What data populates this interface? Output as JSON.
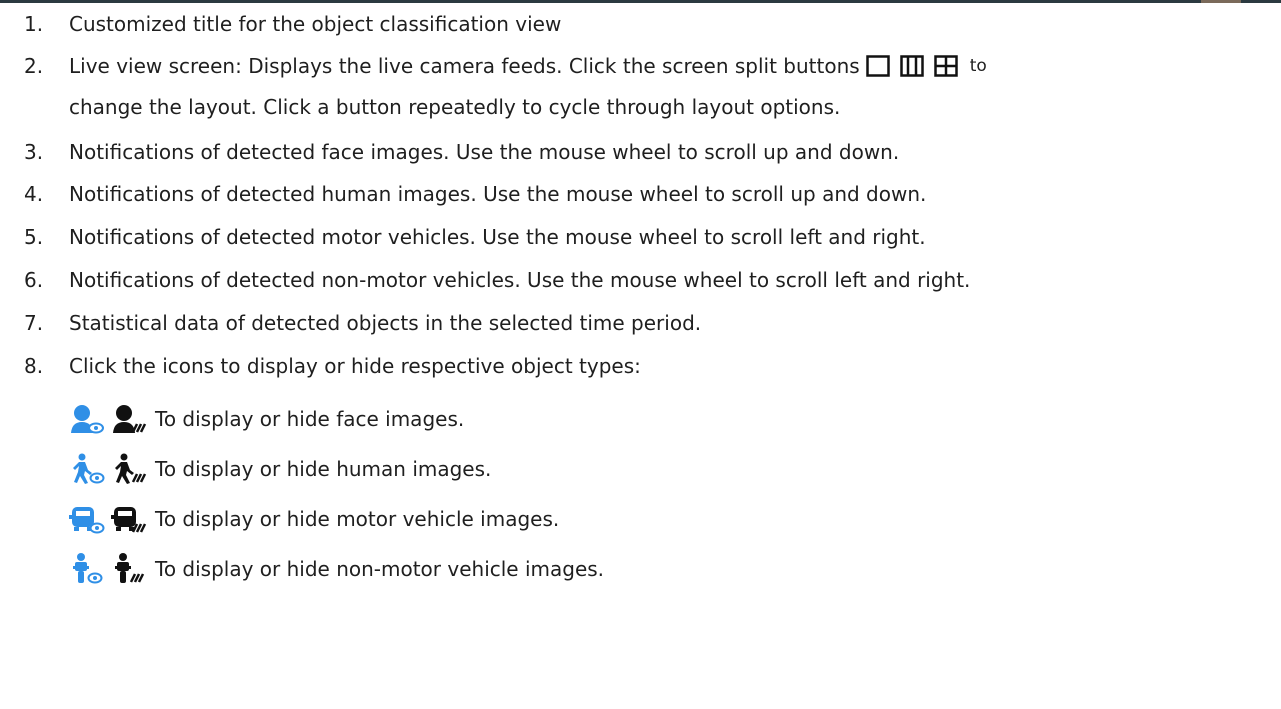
{
  "items": [
    {
      "num": "1.",
      "text": "Customized title for the object classification view"
    },
    {
      "num": "2.",
      "text_a": "Live view screen: Displays the live camera feeds. Click the screen split buttons",
      "text_b": "to",
      "text_c": "change the layout. Click a button repeatedly to cycle through layout options."
    },
    {
      "num": "3.",
      "text": "Notifications of detected face images. Use the mouse wheel to scroll up and down."
    },
    {
      "num": "4.",
      "text": "Notifications of detected human images. Use the mouse wheel to scroll up and down."
    },
    {
      "num": "5.",
      "text": "Notifications of detected motor vehicles. Use the mouse wheel to scroll left and right."
    },
    {
      "num": "6.",
      "text": "Notifications of detected non-motor vehicles. Use the mouse wheel to scroll left and right."
    },
    {
      "num": "7.",
      "text": "Statistical data of detected objects in the selected time period."
    },
    {
      "num": "8.",
      "text": "Click the icons to display or hide respective object types:"
    }
  ],
  "subitems": [
    {
      "icon_show": "face-show-icon",
      "icon_hide": "face-hide-icon",
      "text": "To display or hide face images."
    },
    {
      "icon_show": "human-show-icon",
      "icon_hide": "human-hide-icon",
      "text": "To display or hide human images."
    },
    {
      "icon_show": "motor-vehicle-show-icon",
      "icon_hide": "motor-vehicle-hide-icon",
      "text": "To display or hide motor vehicle images."
    },
    {
      "icon_show": "non-motor-vehicle-show-icon",
      "icon_hide": "non-motor-vehicle-hide-icon",
      "text": "To display or hide non-motor vehicle images."
    }
  ],
  "colors": {
    "icon_blue": "#2f8fe6",
    "icon_black": "#111111",
    "text": "#1f1f1f"
  }
}
